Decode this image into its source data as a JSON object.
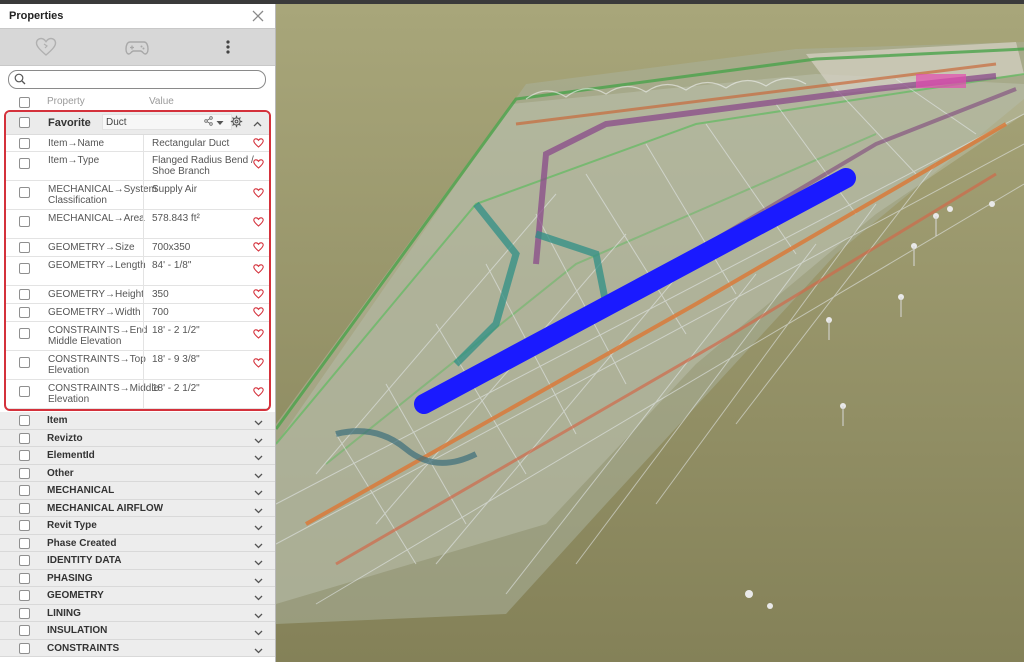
{
  "panel": {
    "title": "Properties",
    "search": {
      "value": "",
      "placeholder": ""
    },
    "columns": {
      "property": "Property",
      "value": "Value"
    }
  },
  "favorite": {
    "title": "Favorite",
    "selected": "Duct",
    "rows": [
      {
        "name": "Item→Name",
        "value": "Rectangular Duct"
      },
      {
        "name": "Item→Type",
        "value": "Flanged Radius Bend / Shoe Branch"
      },
      {
        "name": "MECHANICAL→System Classification",
        "value": "Supply Air"
      },
      {
        "name": "MECHANICAL→Area",
        "value": "578.843 ft²"
      },
      {
        "name": "GEOMETRY→Size",
        "value": "700x350"
      },
      {
        "name": "GEOMETRY→Length",
        "value": "84' - 1/8\""
      },
      {
        "name": "GEOMETRY→Height",
        "value": "350"
      },
      {
        "name": "GEOMETRY→Width",
        "value": "700"
      },
      {
        "name": "CONSTRAINTS→End Middle Elevation",
        "value": "18' - 2 1/2\""
      },
      {
        "name": "CONSTRAINTS→Top Elevation",
        "value": "18' - 9 3/8\""
      },
      {
        "name": "CONSTRAINTS→Middle Elevation",
        "value": "18' - 2 1/2\""
      }
    ]
  },
  "groups": [
    "Item",
    "Revizto",
    "ElementId",
    "Other",
    "MECHANICAL",
    "MECHANICAL AIRFLOW",
    "Revit Type",
    "Phase Created",
    "IDENTITY DATA",
    "PHASING",
    "GEOMETRY",
    "LINING",
    "INSULATION",
    "CONSTRAINTS"
  ],
  "colors": {
    "highlight_border": "#d4313b",
    "selected_duct": "#1a1aff",
    "ground": "#8e8a5f",
    "heart": "#d4313b"
  },
  "icons": {
    "close": "close-icon",
    "heart_tool": "heart-outline-icon",
    "gamepad": "gamepad-icon",
    "more": "more-vertical-icon",
    "search": "search-icon",
    "share": "share-icon",
    "dropdown": "caret-down-icon",
    "settings": "gear-icon",
    "collapse": "chevron-up-icon",
    "expand": "chevron-down-icon",
    "favorite": "heart-icon"
  }
}
